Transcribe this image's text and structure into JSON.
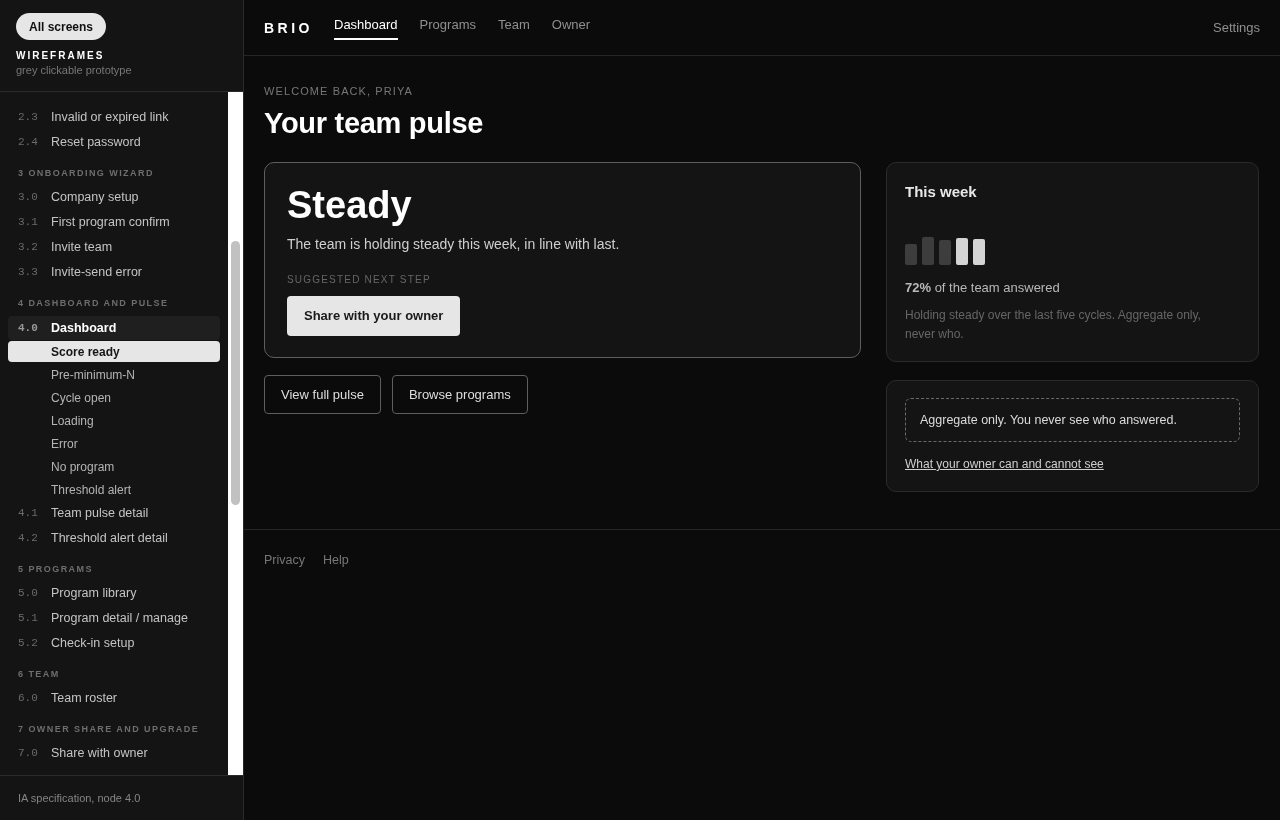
{
  "sidebar": {
    "all_screens_button": "All screens",
    "title": "WIREFRAMES",
    "subtitle": "grey clickable prototype",
    "sections": [
      {
        "items": [
          {
            "number": "2.3",
            "label": "Invalid or expired link",
            "selected": false
          },
          {
            "number": "2.4",
            "label": "Reset password",
            "selected": false
          }
        ]
      },
      {
        "heading": "3 ONBOARDING WIZARD",
        "items": [
          {
            "number": "3.0",
            "label": "Company setup",
            "selected": false
          },
          {
            "number": "3.1",
            "label": "First program confirm",
            "selected": false
          },
          {
            "number": "3.2",
            "label": "Invite team",
            "selected": false
          },
          {
            "number": "3.3",
            "label": "Invite-send error",
            "selected": false
          }
        ]
      },
      {
        "heading": "4 DASHBOARD AND PULSE",
        "items": [
          {
            "number": "4.0",
            "label": "Dashboard",
            "selected": true,
            "children": [
              {
                "label": "Score ready",
                "selected": true
              },
              {
                "label": "Pre-minimum-N",
                "selected": false
              },
              {
                "label": "Cycle open",
                "selected": false
              },
              {
                "label": "Loading",
                "selected": false
              },
              {
                "label": "Error",
                "selected": false
              },
              {
                "label": "No program",
                "selected": false
              },
              {
                "label": "Threshold alert",
                "selected": false
              }
            ]
          },
          {
            "number": "4.1",
            "label": "Team pulse detail",
            "selected": false
          },
          {
            "number": "4.2",
            "label": "Threshold alert detail",
            "selected": false
          }
        ]
      },
      {
        "heading": "5 PROGRAMS",
        "items": [
          {
            "number": "5.0",
            "label": "Program library",
            "selected": false
          },
          {
            "number": "5.1",
            "label": "Program detail / manage",
            "selected": false
          },
          {
            "number": "5.2",
            "label": "Check-in setup",
            "selected": false
          }
        ]
      },
      {
        "heading": "6 TEAM",
        "items": [
          {
            "number": "6.0",
            "label": "Team roster",
            "selected": false
          }
        ]
      },
      {
        "heading": "7 OWNER SHARE AND UPGRADE",
        "items": [
          {
            "number": "7.0",
            "label": "Share with owner",
            "selected": false
          }
        ]
      }
    ],
    "footer": "IA specification, node 4.0"
  },
  "nav": {
    "brand": "BRIO",
    "tabs": [
      {
        "label": "Dashboard",
        "selected": true
      },
      {
        "label": "Programs",
        "selected": false
      },
      {
        "label": "Team",
        "selected": false
      },
      {
        "label": "Owner",
        "selected": false
      }
    ],
    "settings": "Settings"
  },
  "page": {
    "eyebrow": "WELCOME BACK, PRIYA",
    "title": "Your team pulse"
  },
  "pulse_card": {
    "status": "Steady",
    "summary": "The team is holding steady this week, in line with last.",
    "next_step_label": "SUGGESTED NEXT STEP",
    "next_step_button": "Share with your owner"
  },
  "actions": [
    "View full pulse",
    "Browse programs"
  ],
  "this_week": {
    "title": "This week",
    "response": "**72%** of the team answered",
    "note": "Holding steady over the last five cycles. Aggregate only, never who."
  },
  "privacy": {
    "notice": "Aggregate only. You never see who answered.",
    "link": "What your owner can and cannot see"
  },
  "footer_links": [
    "Privacy",
    "Help"
  ]
}
